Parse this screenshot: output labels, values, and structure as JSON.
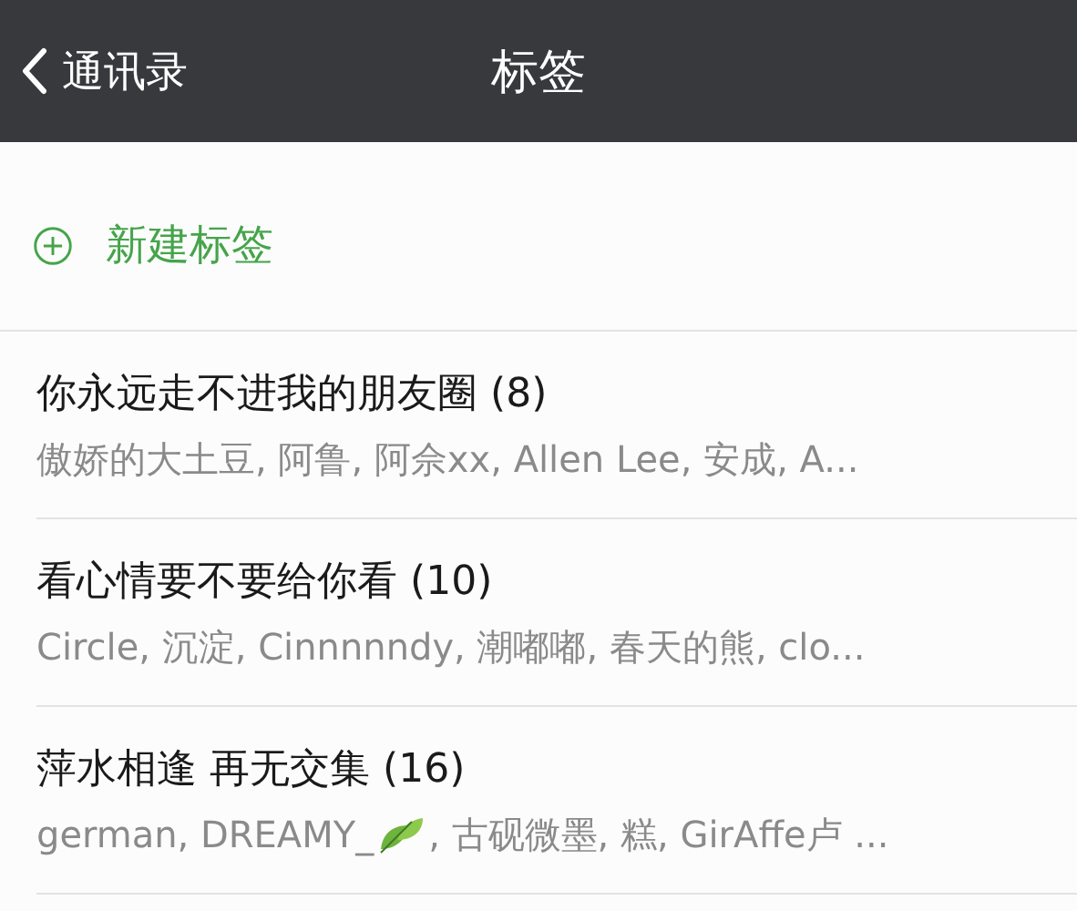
{
  "nav_bar": {
    "back_label": "通讯录",
    "title": "标签"
  },
  "new_tag": {
    "label": "新建标签"
  },
  "tags": [
    {
      "name": "你永远走不进我的朋友圈 (8)",
      "members": [
        {
          "kind": "text",
          "text": "傲娇的大土豆, 阿鲁, 阿佘xx, Allen Lee, 安成, A..."
        }
      ]
    },
    {
      "name": "看心情要不要给你看 (10)",
      "members": [
        {
          "kind": "text",
          "text": "Circle, 沉淀, Cinnnnndy, 潮嘟嘟, 春天的熊, clo..."
        }
      ]
    },
    {
      "name": "萍水相逢 再无交集 (16)",
      "members": [
        {
          "kind": "text",
          "text": "german, DREAMY_"
        },
        {
          "kind": "leaf"
        },
        {
          "kind": "text",
          "text": ", 古砚微墨, 糕, GirAffe卢 ..."
        }
      ]
    }
  ]
}
